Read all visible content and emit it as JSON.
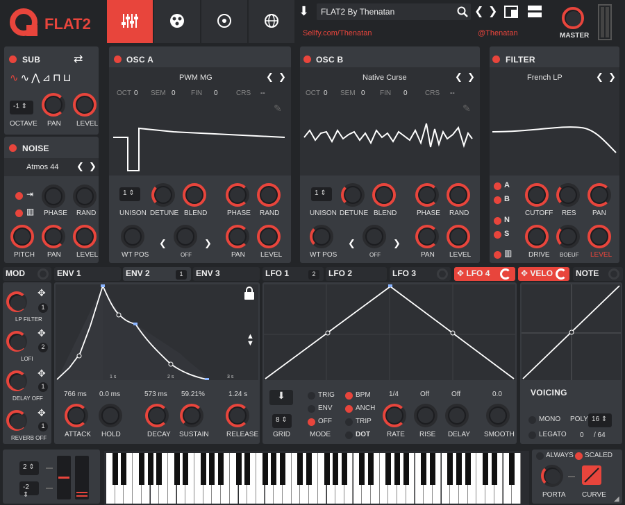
{
  "header": {
    "logo": "FLAT2",
    "preset_name": "FLAT2 By Thenatan",
    "link_left": "Sellfy.com/Thenatan",
    "link_right": "@Thenatan",
    "master_label": "MASTER"
  },
  "sub": {
    "title": "SUB",
    "octave_value": "-1",
    "labels": [
      "OCTAVE",
      "PAN",
      "LEVEL"
    ]
  },
  "noise": {
    "title": "NOISE",
    "preset": "Atmos 44",
    "labels": [
      "PHASE",
      "RAND",
      "PITCH",
      "PAN",
      "LEVEL"
    ]
  },
  "osc_a": {
    "title": "OSC A",
    "preset": "PWM MG",
    "params": [
      "OCT",
      "SEM",
      "FIN",
      "CRS"
    ],
    "param_values": [
      "0",
      "0",
      "0",
      "--"
    ],
    "unison": "1",
    "labels": [
      "UNISON",
      "DETUNE",
      "BLEND",
      "PHASE",
      "RAND",
      "WT POS",
      "OFF",
      "PAN",
      "LEVEL"
    ]
  },
  "osc_b": {
    "title": "OSC B",
    "preset": "Native Curse",
    "params": [
      "OCT",
      "SEM",
      "FIN",
      "CRS"
    ],
    "param_values": [
      "0",
      "0",
      "0",
      "--"
    ],
    "unison": "1",
    "labels": [
      "UNISON",
      "DETUNE",
      "BLEND",
      "PHASE",
      "RAND",
      "WT POS",
      "OFF",
      "PAN",
      "LEVEL"
    ]
  },
  "filter": {
    "title": "FILTER",
    "preset": "French LP",
    "routes": [
      "A",
      "B",
      "N",
      "S"
    ],
    "labels": [
      "CUTOFF",
      "RES",
      "PAN",
      "DRIVE",
      "BOEUF",
      "LEVEL"
    ]
  },
  "tabs": [
    {
      "label": "MOD"
    },
    {
      "label": "ENV 1"
    },
    {
      "label": "ENV 2",
      "badge": "1"
    },
    {
      "label": "ENV 3"
    },
    {
      "label": "LFO 1",
      "badge": "2"
    },
    {
      "label": "LFO 2"
    },
    {
      "label": "LFO 3"
    },
    {
      "label": "LFO 4"
    },
    {
      "label": "VELO"
    },
    {
      "label": "NOTE"
    }
  ],
  "mod": {
    "slots": [
      {
        "label": "LP FILTER",
        "num": "1"
      },
      {
        "label": "LOFI",
        "num": "2"
      },
      {
        "label": "DELAY OFF",
        "num": "1"
      },
      {
        "label": "REVERB OFF",
        "num": "1"
      }
    ]
  },
  "env": {
    "ticks": [
      "1 s",
      "2 s",
      "3 s"
    ],
    "values": [
      "766 ms",
      "0.0 ms",
      "573 ms",
      "59.21%",
      "1.24 s"
    ],
    "labels": [
      "ATTACK",
      "HOLD",
      "DECAY",
      "SUSTAIN",
      "RELEASE"
    ]
  },
  "lfo": {
    "grid": "8",
    "modes": [
      "TRIG",
      "ENV",
      "OFF"
    ],
    "sync": [
      "BPM",
      "ANCH",
      "TRIP",
      "DOT"
    ],
    "values": [
      "1/4",
      "Off",
      "Off",
      "0.0"
    ],
    "labels": [
      "GRID",
      "MODE",
      "RATE",
      "RISE",
      "DELAY",
      "SMOOTH"
    ]
  },
  "voicing": {
    "title": "VOICING",
    "mono": "MONO",
    "legato": "LEGATO",
    "poly_label": "POLY",
    "poly_value": "16",
    "count": "0",
    "count_max": "/ 64"
  },
  "bottom": {
    "pitch_up": "2",
    "pitch_down": "-2",
    "always": "ALWAYS",
    "scaled": "SCALED",
    "porta": "PORTA",
    "curve": "CURVE"
  },
  "colors": {
    "accent": "#e8453c",
    "panel": "#383b40",
    "bg": "#232528"
  }
}
